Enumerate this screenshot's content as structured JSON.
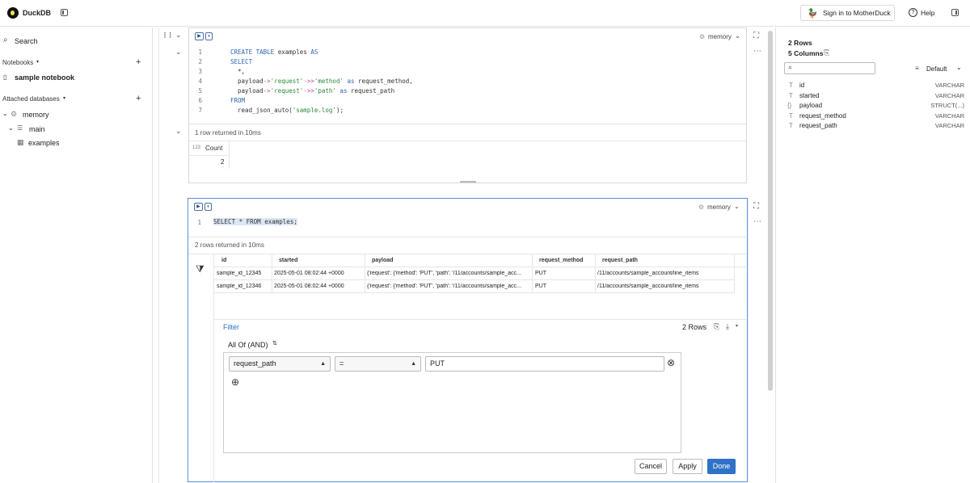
{
  "app": {
    "title": "DuckDB"
  },
  "header": {
    "signin_label": "Sign in to MotherDuck",
    "help_label": "Help"
  },
  "sidebar": {
    "search_label": "Search",
    "notebooks_label": "Notebooks",
    "notebook_item": "sample notebook",
    "attached_label": "Attached databases",
    "tree": {
      "memory": "memory",
      "main": "main",
      "examples": "examples"
    }
  },
  "cell1": {
    "db": "memory",
    "lines": [
      "1",
      "2",
      "3",
      "4",
      "5",
      "6",
      "7"
    ],
    "status": "1 row returned in 10ms",
    "result": {
      "type_badge": "123",
      "header": "Count",
      "value": "2"
    }
  },
  "cell2": {
    "db": "memory",
    "lines": [
      "1"
    ],
    "code": "SELECT * FROM examples;",
    "status": "2 rows returned in 10ms",
    "table": {
      "columns": [
        "id",
        "started",
        "payload",
        "request_method",
        "request_path"
      ],
      "rows": [
        [
          "sample_id_12345",
          "2025-05-01 08:02:44 +0000",
          "{'request': {'method': 'PUT', 'path': '/11/accounts/sample_acc...",
          "PUT",
          "/11/accounts/sample_account/line_items"
        ],
        [
          "sample_id_12346",
          "2025-05-01 08:02:44 +0000",
          "{'request': {'method': 'PUT', 'path': '/11/accounts/sample_acc...",
          "PUT",
          "/11/accounts/sample_account/line_items"
        ]
      ]
    },
    "filter": {
      "label": "Filter",
      "rows_label": "2 Rows",
      "combinator": "All Of (AND)",
      "column": "request_path",
      "operator": "=",
      "value": "PUT",
      "cancel": "Cancel",
      "apply": "Apply",
      "done": "Done"
    }
  },
  "right_panel": {
    "rows": "2 Rows",
    "columns": "5 Columns",
    "sort": "Default",
    "cols": [
      {
        "icon": "T",
        "name": "id",
        "type": "VARCHAR"
      },
      {
        "icon": "T",
        "name": "started",
        "type": "VARCHAR"
      },
      {
        "icon": "{}",
        "name": "payload",
        "type": "STRUCT(...)"
      },
      {
        "icon": "T",
        "name": "request_method",
        "type": "VARCHAR"
      },
      {
        "icon": "T",
        "name": "request_path",
        "type": "VARCHAR"
      }
    ]
  }
}
